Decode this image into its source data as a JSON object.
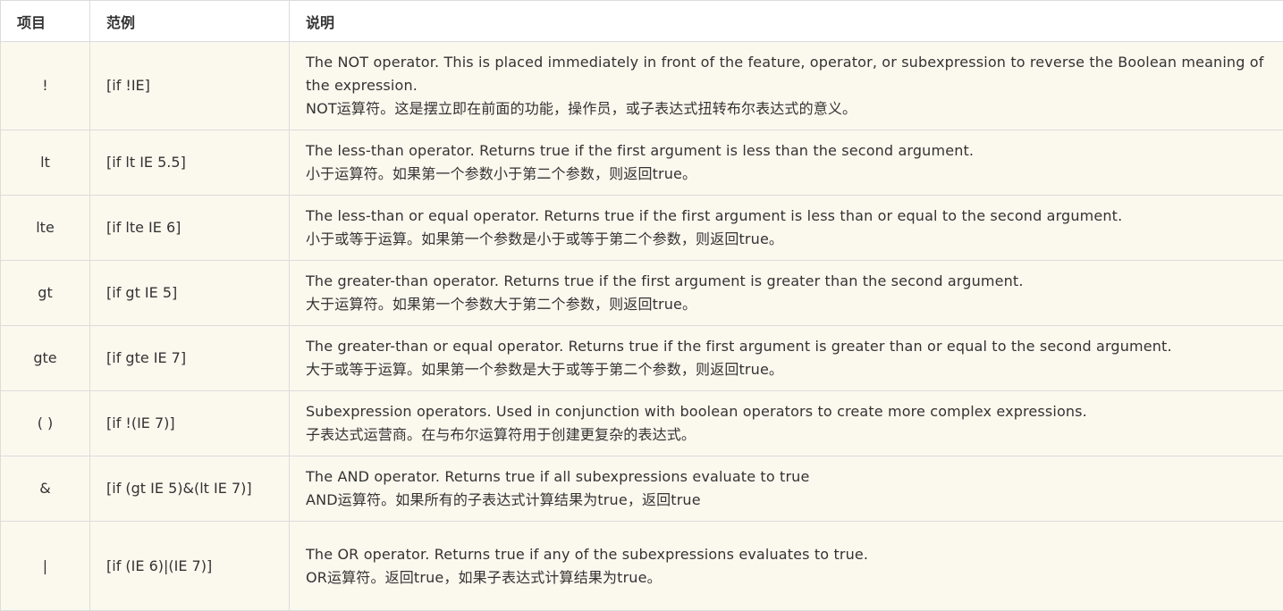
{
  "table": {
    "headers": {
      "item": "项目",
      "example": "范例",
      "description": "说明"
    },
    "rows": [
      {
        "op": "!",
        "example": "[if !IE]",
        "desc_en": "The NOT operator. This is placed immediately in front of the feature, operator, or subexpression to reverse the Boolean meaning of the expression.",
        "desc_zh": "NOT运算符。这是摆立即在前面的功能，操作员，或子表达式扭转布尔表达式的意义。"
      },
      {
        "op": "lt",
        "example": "[if lt IE 5.5]",
        "desc_en": "The less-than operator. Returns true if the first argument is less than the second argument.",
        "desc_zh": "小于运算符。如果第一个参数小于第二个参数，则返回true。"
      },
      {
        "op": "lte",
        "example": "[if lte IE 6]",
        "desc_en": "The less-than or equal operator. Returns true if the first argument is less than or equal to the second argument.",
        "desc_zh": "小于或等于运算。如果第一个参数是小于或等于第二个参数，则返回true。"
      },
      {
        "op": "gt",
        "example": "[if gt IE 5]",
        "desc_en": "The greater-than operator. Returns true if the first argument is greater than the second argument.",
        "desc_zh": "大于运算符。如果第一个参数大于第二个参数，则返回true。"
      },
      {
        "op": "gte",
        "example": "[if gte IE 7]",
        "desc_en": "The greater-than or equal operator. Returns true if the first argument is greater than or equal to the second argument.",
        "desc_zh": "大于或等于运算。如果第一个参数是大于或等于第二个参数，则返回true。"
      },
      {
        "op": "( )",
        "example": "[if !(IE 7)]",
        "desc_en": "Subexpression operators. Used in conjunction with boolean operators to create more complex expressions.",
        "desc_zh": "子表达式运营商。在与布尔运算符用于创建更复杂的表达式。"
      },
      {
        "op": "&",
        "example": "[if (gt IE 5)&(lt IE 7)]",
        "desc_en": "The AND operator. Returns true if all subexpressions evaluate to true",
        "desc_zh": "AND运算符。如果所有的子表达式计算结果为true，返回true"
      },
      {
        "op": "|",
        "example": "[if (IE 6)|(IE 7)]",
        "desc_en": "The OR operator. Returns true if any of the subexpressions evaluates to true.",
        "desc_zh": "OR运算符。返回true，如果子表达式计算结果为true。"
      }
    ]
  },
  "colors": {
    "row_background": "#fbf8ee",
    "header_background": "#ffffff",
    "border": "#dcdcdc",
    "text": "#333333"
  }
}
